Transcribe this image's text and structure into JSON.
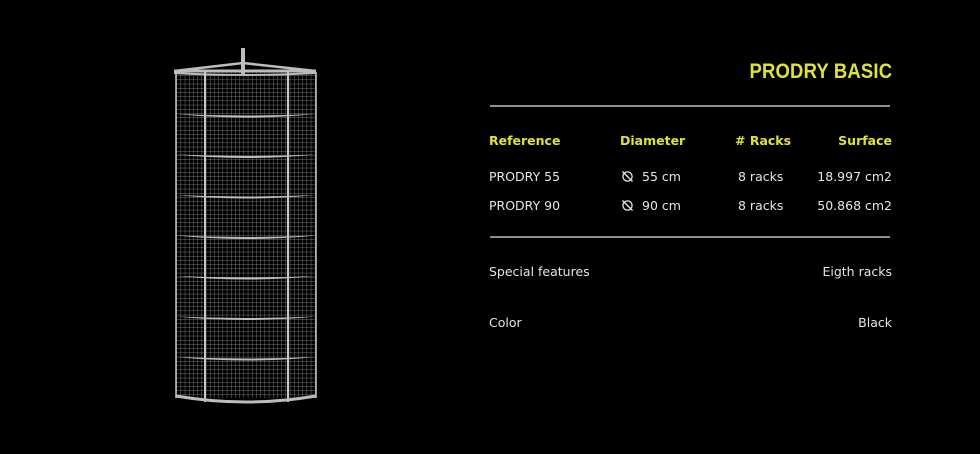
{
  "product": {
    "title": "PRODRY BASIC"
  },
  "table": {
    "headers": {
      "reference": "Reference",
      "diameter": "Diameter",
      "racks": "# Racks",
      "surface": "Surface"
    },
    "rows": [
      {
        "reference": "PRODRY 55",
        "diameter": "55 cm",
        "racks": "8 racks",
        "surface": "18.997 cm2"
      },
      {
        "reference": "PRODRY 90",
        "diameter": "90 cm",
        "racks": "8 racks",
        "surface": "50.868 cm2"
      }
    ]
  },
  "features": {
    "special_label": "Special features",
    "special_value": "Eigth racks",
    "color_label": "Color",
    "color_value": "Black"
  },
  "icons": {
    "diameter": "diameter-icon",
    "product": "drying-rack-illustration"
  },
  "colors": {
    "background": "#000000",
    "accent": "#dfe23a",
    "text": "#e6e6e6",
    "divider": "#8e8e8e",
    "illustration": "#bdbdbd"
  }
}
